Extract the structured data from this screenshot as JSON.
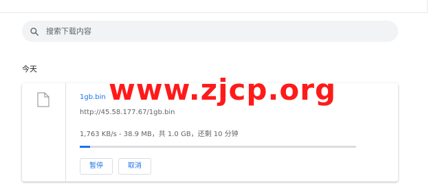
{
  "search": {
    "placeholder": "搜索下载内容",
    "icon": "search-icon"
  },
  "section": {
    "heading": "今天"
  },
  "download": {
    "file_icon": "file-icon",
    "file_name": "1gb.bin",
    "url": "http://45.58.177.67/1gb.bin",
    "status": "1,763 KB/s - 38.9 MB，共 1.0 GB，还剩 10 分钟",
    "progress_fraction": 0.038,
    "pause_label": "暂停",
    "cancel_label": "取消"
  },
  "watermark": {
    "text": "www.zjcp.org"
  },
  "colors": {
    "accent": "#1a73e8",
    "watermark": "#ff1a1a",
    "search_bg": "#f1f3f4"
  }
}
